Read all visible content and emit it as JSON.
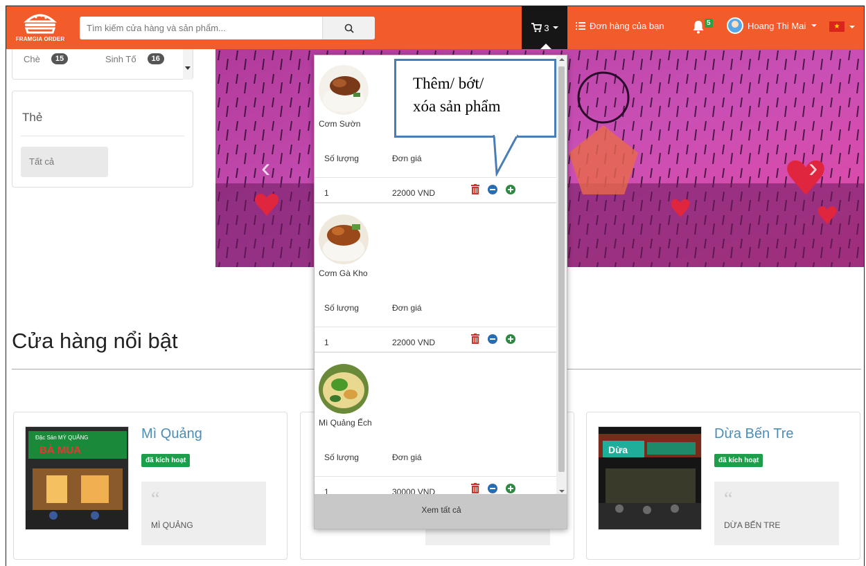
{
  "navbar": {
    "logo_text": "FRAMGIA ORDER",
    "search_placeholder": "Tìm kiếm cửa hàng và sản phẩm...",
    "cart_count": "3",
    "orders_label": "Đơn hàng của bạn",
    "notification_count": "5",
    "user_name": "Hoang Thi Mai",
    "language_flag": "Vietnam"
  },
  "sidebar": {
    "categories": [
      {
        "label": "Chè",
        "count": "15"
      },
      {
        "label": "Sinh Tố",
        "count": "16"
      }
    ],
    "tags_title": "Thẻ",
    "tags_all": "Tất cả"
  },
  "cart": {
    "qty_header": "Số lượng",
    "price_header": "Đơn giá",
    "items": [
      {
        "name": "Cơm Sườn",
        "quantity": "1",
        "price": "22000 VND"
      },
      {
        "name": "Cơm Gà Kho",
        "quantity": "1",
        "price": "22000 VND"
      },
      {
        "name": "Mì Quảng Ếch",
        "quantity": "1",
        "price": "30000 VND"
      }
    ],
    "view_all": "Xem tất cả"
  },
  "callout": {
    "line1": "Thêm/ bớt/",
    "line2": "xóa sản phẩm"
  },
  "featured": {
    "title": "Cửa hàng nổi bật",
    "stores": [
      {
        "name": "Mì Quảng",
        "badge": "đã kích hoạt",
        "quote": "MÌ QUẢNG",
        "sign": "Đặc Sản MỲ QUẢNG",
        "sign2": "BÀ MUA"
      },
      {
        "name": "Dừa Bến Tre",
        "badge": "đã kích hoạt",
        "quote": "DỪA BẾN TRE",
        "sign": "Dừa"
      }
    ]
  },
  "colors": {
    "navbar": "#f25c2a",
    "callout_border": "#4a7db5",
    "badge_green": "#1e9e4a"
  }
}
